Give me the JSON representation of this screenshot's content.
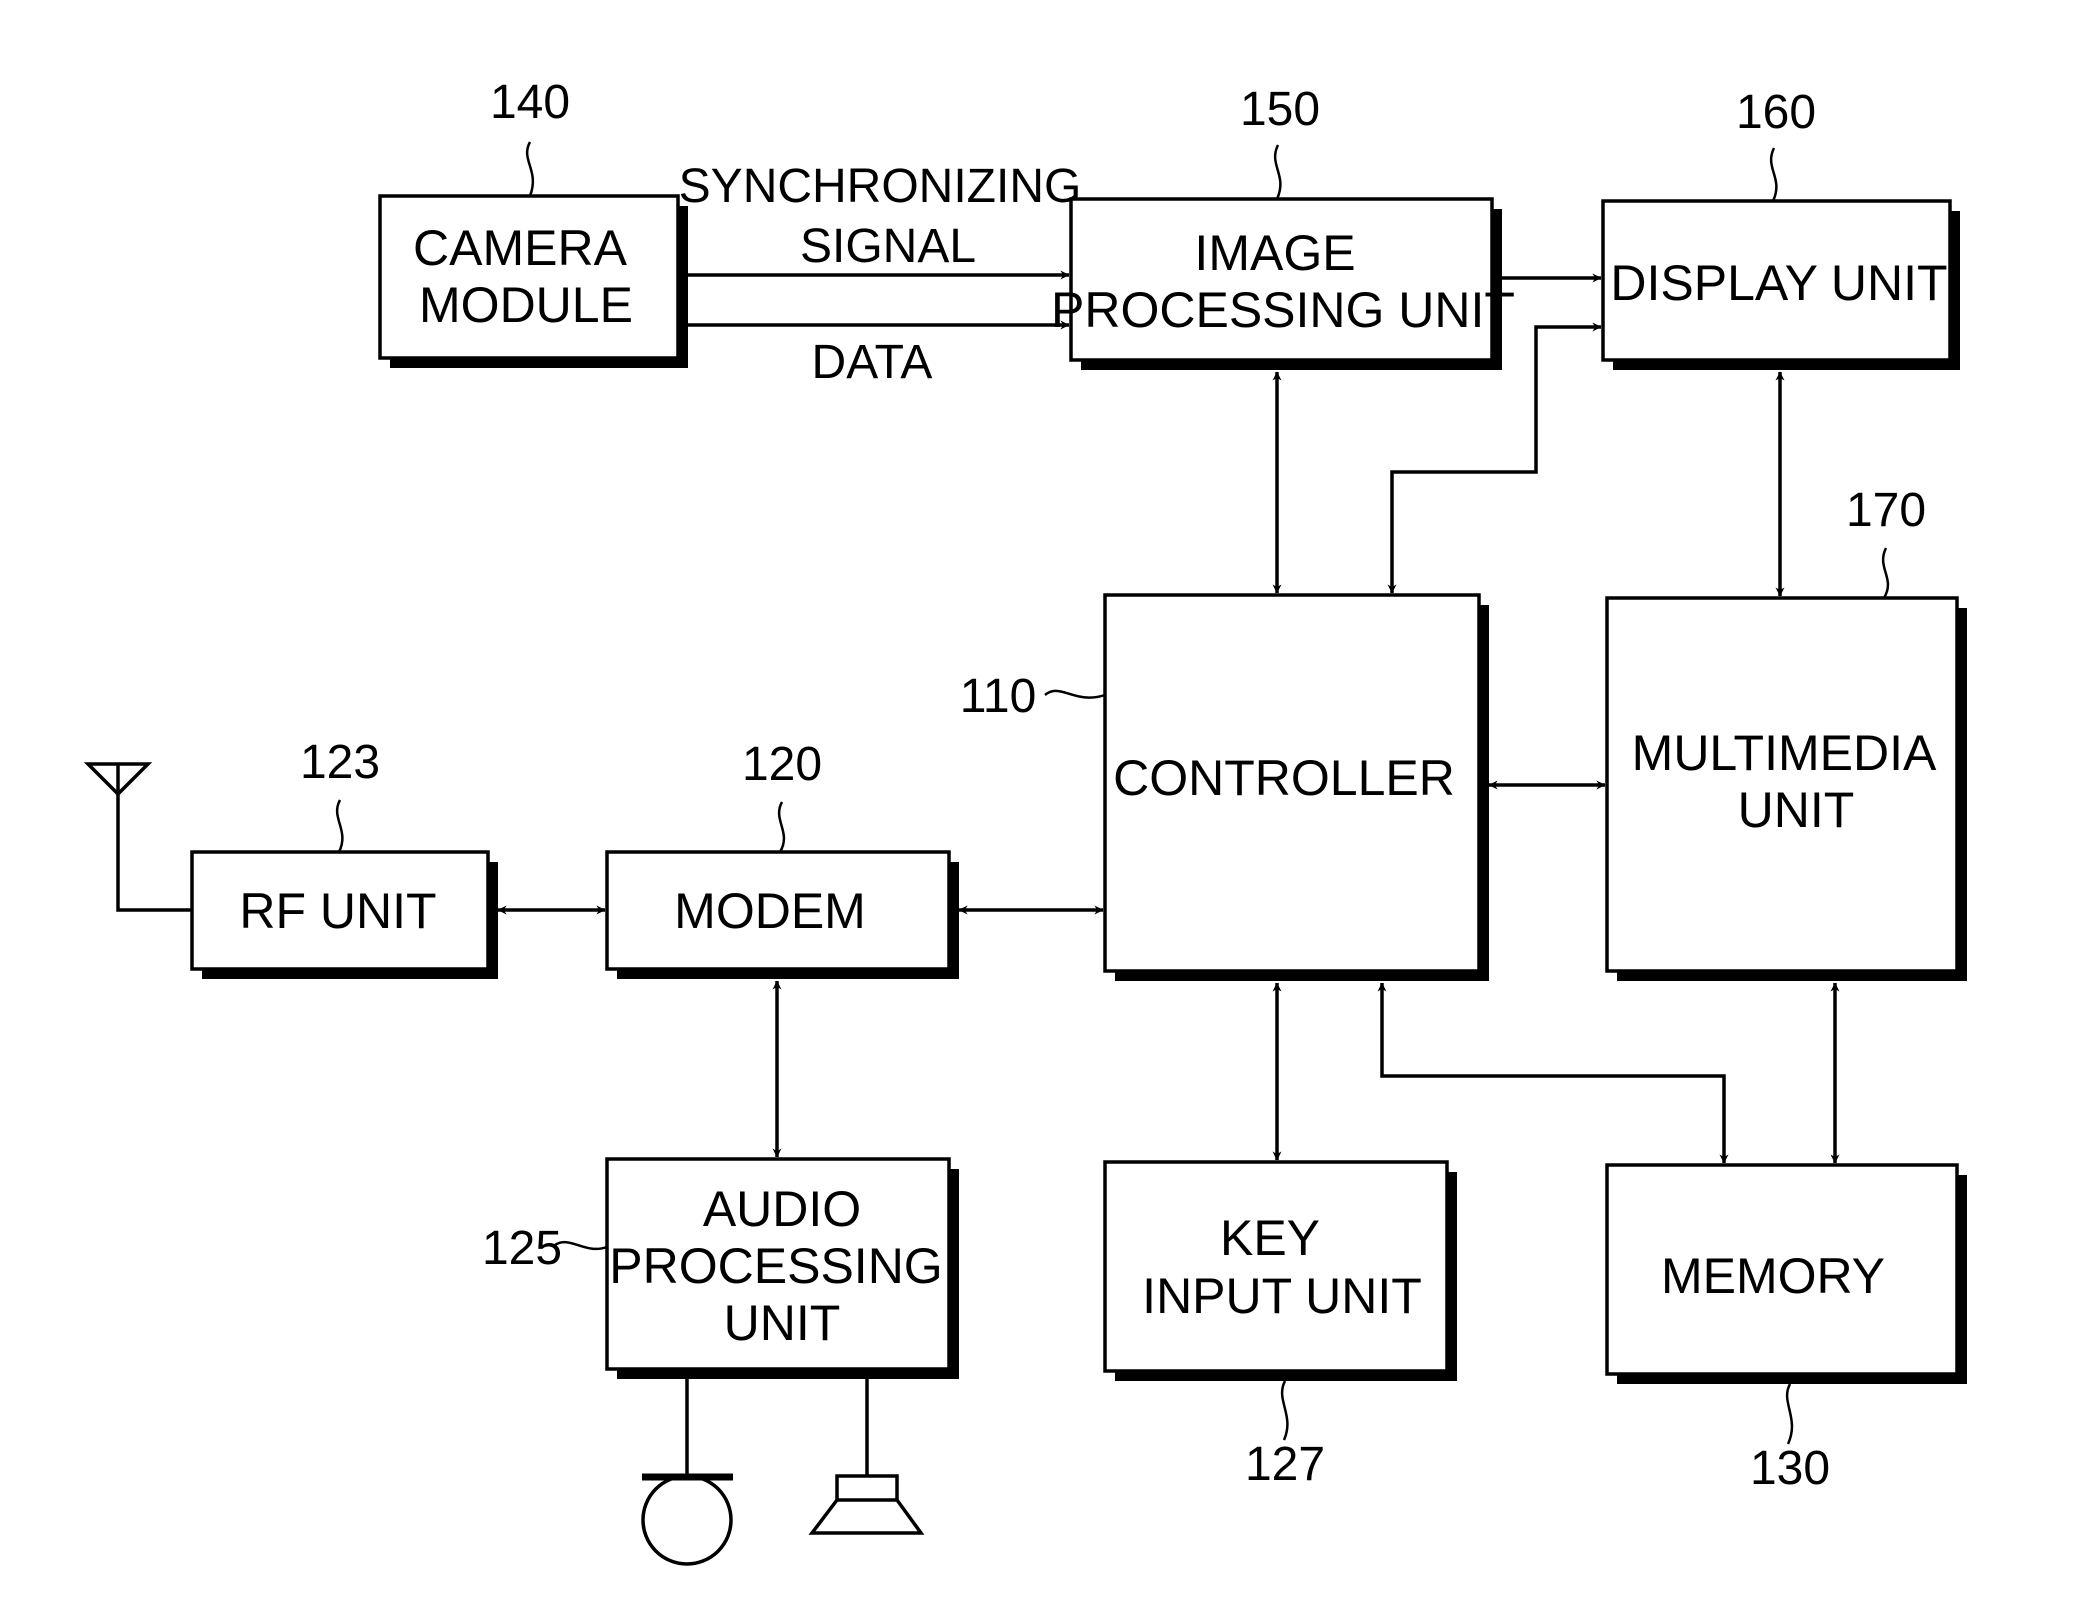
{
  "diagram": {
    "blocks": {
      "camera": {
        "ref": "140",
        "lines": [
          "CAMERA",
          "MODULE"
        ]
      },
      "image_processing": {
        "ref": "150",
        "lines": [
          "IMAGE",
          "PROCESSING UNIT"
        ]
      },
      "display": {
        "ref": "160",
        "lines": [
          "DISPLAY UNIT"
        ]
      },
      "controller": {
        "ref": "110",
        "lines": [
          "CONTROLLER"
        ]
      },
      "multimedia": {
        "ref": "170",
        "lines": [
          "MULTIMEDIA",
          "UNIT"
        ]
      },
      "rf": {
        "ref": "123",
        "lines": [
          "RF UNIT"
        ]
      },
      "modem": {
        "ref": "120",
        "lines": [
          "MODEM"
        ]
      },
      "audio": {
        "ref": "125",
        "lines": [
          "AUDIO",
          "PROCESSING",
          "UNIT"
        ]
      },
      "key_input": {
        "ref": "127",
        "lines": [
          "KEY",
          "INPUT UNIT"
        ]
      },
      "memory": {
        "ref": "130",
        "lines": [
          "MEMORY"
        ]
      }
    },
    "signals": {
      "sync_line1": "SYNCHRONIZING",
      "sync_line2": "SIGNAL",
      "data": "DATA"
    },
    "peripherals": {
      "antenna": "antenna",
      "microphone": "microphone",
      "speaker": "speaker"
    }
  }
}
